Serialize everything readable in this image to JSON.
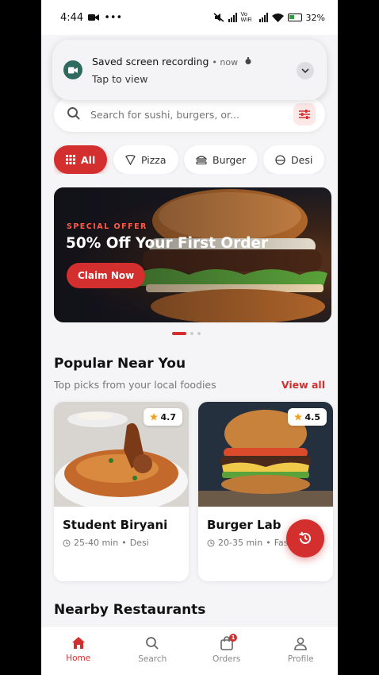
{
  "status_bar": {
    "time": "4:44",
    "extra": "•••",
    "volte": "Vo WiFi",
    "battery": "32%"
  },
  "notification": {
    "title": "Saved screen recording",
    "meta": "now",
    "subtitle": "Tap to view"
  },
  "search": {
    "placeholder": "Search for sushi, burgers, or..."
  },
  "categories": [
    {
      "label": "All",
      "icon": "grid-icon",
      "active": true
    },
    {
      "label": "Pizza",
      "icon": "pizza-icon"
    },
    {
      "label": "Burger",
      "icon": "burger-icon"
    },
    {
      "label": "Desi",
      "icon": "desi-icon"
    }
  ],
  "banner": {
    "tag": "SPECIAL OFFER",
    "title": "50% Off Your First Order",
    "cta": "Claim Now",
    "slides": 3,
    "active_slide": 1
  },
  "popular": {
    "title": "Popular Near You",
    "subtitle": "Top picks from your local foodies",
    "view_all": "View all",
    "items": [
      {
        "name": "Student Biryani",
        "rating": "4.7",
        "time": "25-40 min",
        "category": "Desi"
      },
      {
        "name": "Burger Lab",
        "rating": "4.5",
        "time": "20-35 min",
        "category": "Fast Food"
      }
    ]
  },
  "nearby": {
    "title": "Nearby Restaurants"
  },
  "nav": {
    "items": [
      {
        "label": "Home",
        "icon": "home-icon",
        "active": true
      },
      {
        "label": "Search",
        "icon": "search-icon"
      },
      {
        "label": "Orders",
        "icon": "bag-icon",
        "badge": "1"
      },
      {
        "label": "Profile",
        "icon": "person-icon"
      }
    ]
  },
  "colors": {
    "accent": "#d32f2f",
    "background": "#f5f5f7"
  }
}
